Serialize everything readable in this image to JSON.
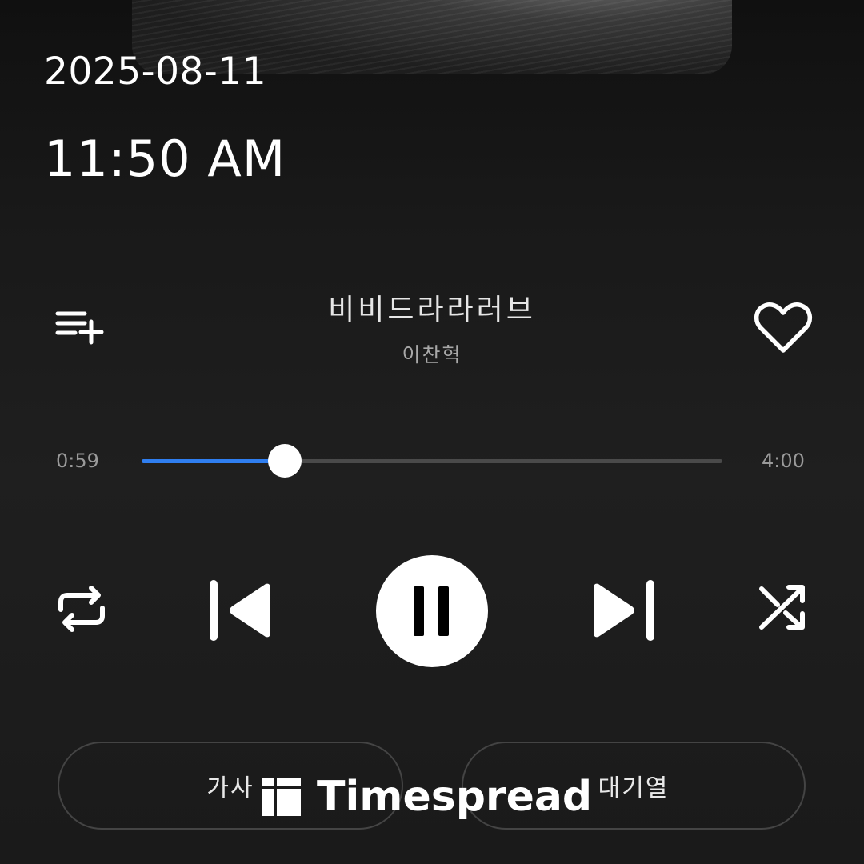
{
  "status": {
    "date": "2025-08-11",
    "time": "11:50 AM"
  },
  "track": {
    "title": "비비드라라러브",
    "artist": "이찬혁"
  },
  "playback": {
    "elapsed": "0:59",
    "duration": "4:00",
    "progress": 0.246,
    "state": "playing"
  },
  "controls": {
    "add_to_playlist_icon": "playlist-add-icon",
    "like_icon": "heart-outline-icon",
    "repeat_icon": "repeat-icon",
    "previous_icon": "skip-previous-icon",
    "play_pause_icon": "pause-icon",
    "next_icon": "skip-next-icon",
    "shuffle_icon": "shuffle-icon"
  },
  "bottom_buttons": {
    "lyrics_label": "가사",
    "queue_label": "대기열"
  },
  "watermark": {
    "text": "Timespread"
  },
  "colors": {
    "accent": "#2f7ef0",
    "background": "#1b1b1b",
    "foreground": "#ffffff"
  }
}
